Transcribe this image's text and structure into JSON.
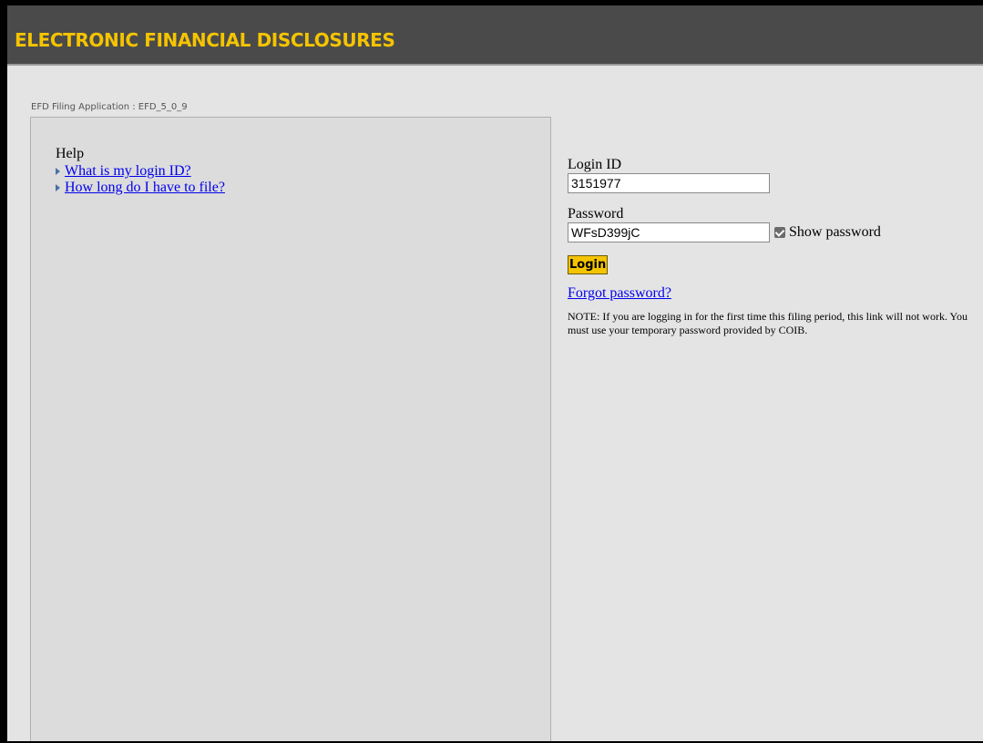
{
  "header": {
    "title": "ELECTRONIC FINANCIAL DISCLOSURES",
    "title_color": "#f5c400",
    "bg_color": "#4a4a4a"
  },
  "app_version": "EFD Filing Application : EFD_5_0_9",
  "help": {
    "title": "Help",
    "links": [
      {
        "label": "What is my login ID?"
      },
      {
        "label": "How long do I have to file?"
      }
    ]
  },
  "login": {
    "login_id_label": "Login ID",
    "login_id_value": "3151977",
    "password_label": "Password",
    "password_value": "WFsD399jC",
    "show_password_label": "Show password",
    "show_password_checked": true,
    "login_button": "Login",
    "forgot_password": "Forgot password?",
    "note": "NOTE: If you are logging in for the first time this filing period, this link will not work. You must use your temporary password provided by COIB."
  }
}
